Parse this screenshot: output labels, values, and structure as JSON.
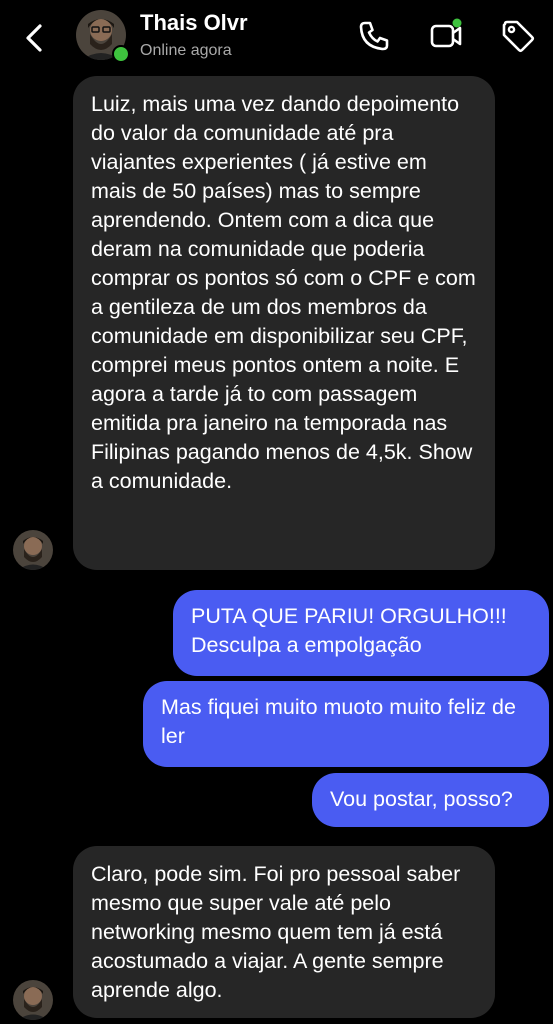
{
  "header": {
    "contact_name": "Thais Olvr",
    "status": "Online agora",
    "online_color": "#3ec33e",
    "icons": [
      "back-chevron-icon",
      "phone-icon",
      "video-call-icon",
      "tag-icon"
    ]
  },
  "messages": [
    {
      "direction": "incoming",
      "text": "Luiz, mais uma vez dando depoimento do valor da comunidade até pra viajantes experientes ( já estive em mais de 50 países) mas to sempre aprendendo. Ontem com a dica que deram na comunidade que poderia comprar os pontos só com o CPF e com a gentileza de um dos membros da comunidade em disponibilizar seu CPF, comprei meus pontos ontem a noite. E agora a tarde já to com passagem emitida pra janeiro na temporada nas Filipinas pagando menos de 4,5k. Show a comunidade."
    },
    {
      "direction": "outgoing",
      "text": "PUTA QUE PARIU! ORGULHO!!! Desculpa a empolgação"
    },
    {
      "direction": "outgoing",
      "text": "Mas fiquei muito muoto muito feliz de ler"
    },
    {
      "direction": "outgoing",
      "text": "Vou postar, posso?"
    },
    {
      "direction": "incoming",
      "text": "Claro, pode sim.  Foi pro pessoal saber mesmo que super vale até pelo networking mesmo quem tem já está acostumado a viajar. A gente sempre aprende algo."
    }
  ],
  "colors": {
    "background": "#000000",
    "incoming_bubble": "#262626",
    "outgoing_bubble": "#4a5cf2",
    "status_text": "#a9a9a9"
  }
}
